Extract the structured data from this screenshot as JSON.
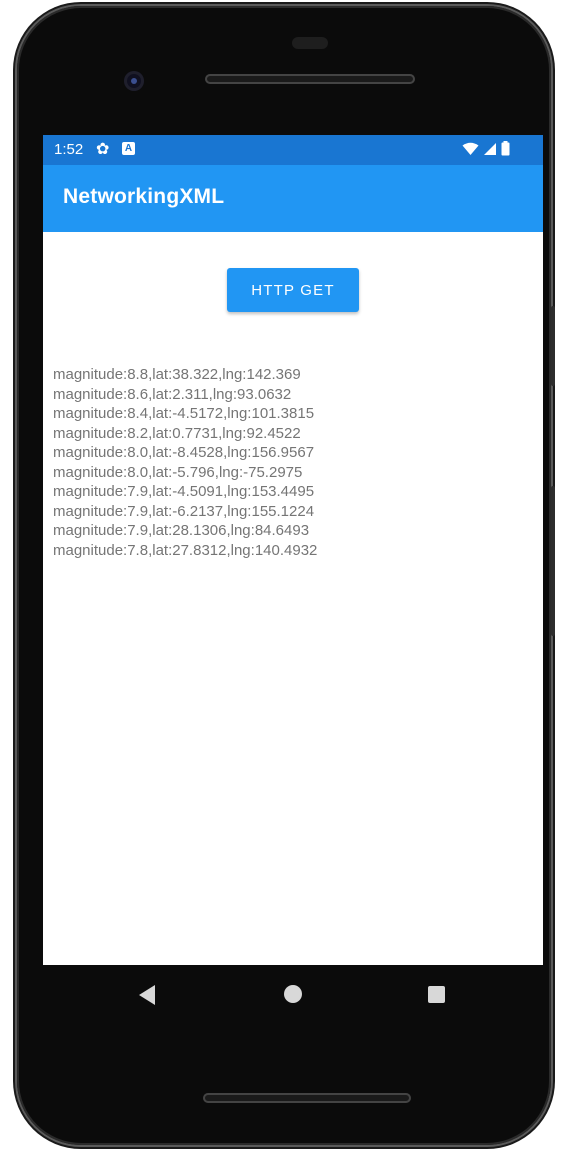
{
  "status_bar": {
    "time": "1:52",
    "icons": [
      "gear-icon",
      "a-notification-icon",
      "wifi-icon",
      "signal-icon",
      "battery-icon"
    ]
  },
  "app_bar": {
    "title": "NetworkingXML"
  },
  "main": {
    "button_label": "HTTP GET",
    "results": [
      "magnitude:8.8,lat:38.322,lng:142.369",
      "magnitude:8.6,lat:2.311,lng:93.0632",
      "magnitude:8.4,lat:-4.5172,lng:101.3815",
      "magnitude:8.2,lat:0.7731,lng:92.4522",
      "magnitude:8.0,lat:-8.4528,lng:156.9567",
      "magnitude:8.0,lat:-5.796,lng:-75.2975",
      "magnitude:7.9,lat:-4.5091,lng:153.4495",
      "magnitude:7.9,lat:-6.2137,lng:155.1224",
      "magnitude:7.9,lat:28.1306,lng:84.6493",
      "magnitude:7.8,lat:27.8312,lng:140.4932"
    ]
  },
  "colors": {
    "status_bar": "#1976d2",
    "app_bar": "#2196f3",
    "button": "#2196f3",
    "result_text": "#757575"
  },
  "nav_bar": {
    "icons": [
      "back-icon",
      "home-icon",
      "recents-icon"
    ]
  }
}
